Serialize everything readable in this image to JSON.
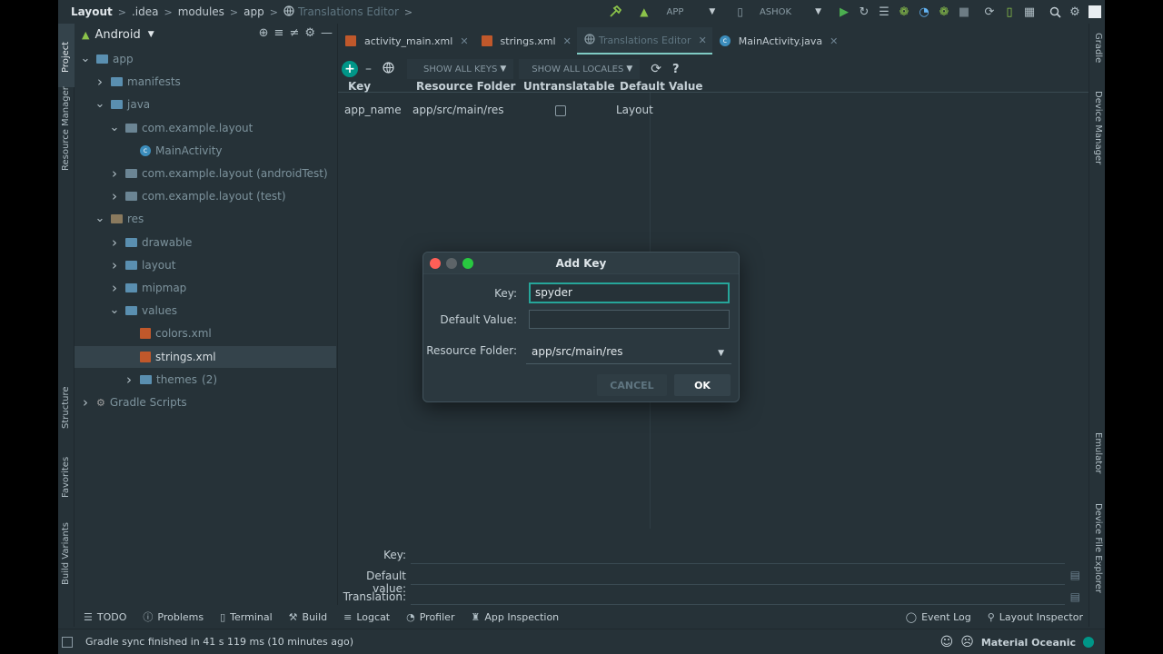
{
  "navbar": {
    "breadcrumbs": [
      "Layout",
      ".idea",
      "modules",
      "app",
      "Translations Editor"
    ],
    "run_config": "APP",
    "device": "ASHOK"
  },
  "left_strip": {
    "project": "Project",
    "resource_manager": "Resource Manager",
    "structure": "Structure",
    "favorites": "Favorites",
    "build_variants": "Build Variants"
  },
  "right_strip": {
    "gradle": "Gradle",
    "device_manager": "Device Manager",
    "emulator": "Emulator",
    "device_file_explorer": "Device File Explorer"
  },
  "project_panel": {
    "view_mode": "Android",
    "tree": [
      {
        "label": "app",
        "indent": 0,
        "icon": "folder-icon",
        "expanded": true,
        "style": "dim"
      },
      {
        "label": "manifests",
        "indent": 1,
        "icon": "folder-icon",
        "expanded": false,
        "style": "dim"
      },
      {
        "label": "java",
        "indent": 1,
        "icon": "folder-icon",
        "expanded": true,
        "style": "dim"
      },
      {
        "label": "com.example.layout",
        "indent": 2,
        "icon": "package-icon",
        "expanded": true,
        "style": "dim"
      },
      {
        "label": "MainActivity",
        "indent": 3,
        "icon": "class-icon",
        "expanded": null,
        "style": "dim"
      },
      {
        "label": "com.example.layout (androidTest)",
        "indent": 2,
        "icon": "package-icon",
        "expanded": false,
        "style": "dim"
      },
      {
        "label": "com.example.layout (test)",
        "indent": 2,
        "icon": "package-icon",
        "expanded": false,
        "style": "dim"
      },
      {
        "label": "res",
        "indent": 1,
        "icon": "res-folder-icon",
        "expanded": true,
        "style": "dim"
      },
      {
        "label": "drawable",
        "indent": 2,
        "icon": "folder-icon",
        "expanded": false,
        "style": "dim"
      },
      {
        "label": "layout",
        "indent": 2,
        "icon": "folder-icon",
        "expanded": false,
        "style": "dim"
      },
      {
        "label": "mipmap",
        "indent": 2,
        "icon": "folder-icon",
        "expanded": false,
        "style": "dim"
      },
      {
        "label": "values",
        "indent": 2,
        "icon": "folder-icon",
        "expanded": true,
        "style": "dim"
      },
      {
        "label": "colors.xml",
        "indent": 3,
        "icon": "xml-file-icon",
        "expanded": null,
        "style": "dim"
      },
      {
        "label": "strings.xml",
        "indent": 3,
        "icon": "xml-file-icon",
        "expanded": null,
        "style": "selected"
      },
      {
        "label": "themes",
        "extra": "(2)",
        "indent": 3,
        "icon": "folder-icon",
        "expanded": false,
        "style": "dim"
      },
      {
        "label": "Gradle Scripts",
        "indent": 0,
        "icon": "gradle-icon",
        "expanded": false,
        "style": "dim"
      }
    ]
  },
  "editor_tabs": [
    {
      "label": "activity_main.xml",
      "icon": "xml-file-icon",
      "active": false
    },
    {
      "label": "strings.xml",
      "icon": "xml-file-icon",
      "active": false
    },
    {
      "label": "Translations Editor",
      "icon": "globe-icon",
      "active": true
    },
    {
      "label": "MainActivity.java",
      "icon": "class-icon",
      "active": false
    }
  ],
  "translations_toolbar": {
    "show_keys": "SHOW ALL KEYS",
    "show_locales": "SHOW ALL LOCALES",
    "help": "?"
  },
  "table": {
    "headers": [
      "Key",
      "Resource Folder",
      "Untranslatable",
      "Default Value"
    ],
    "rows": [
      {
        "key": "app_name",
        "folder": "app/src/main/res",
        "untranslatable": false,
        "default_value": "Layout"
      }
    ]
  },
  "bottom_fields": {
    "key_label": "Key:",
    "default_label": "Default value:",
    "translation_label": "Translation:"
  },
  "dialog": {
    "title": "Add Key",
    "key_label": "Key:",
    "key_value": "spyder",
    "default_label": "Default Value:",
    "default_value": "",
    "folder_label": "Resource Folder:",
    "folder_value": "app/src/main/res",
    "cancel": "CANCEL",
    "ok": "OK"
  },
  "bottom_tools": {
    "todo": "TODO",
    "problems": "Problems",
    "terminal": "Terminal",
    "build": "Build",
    "logcat": "Logcat",
    "profiler": "Profiler",
    "app_inspection": "App Inspection",
    "event_log": "Event Log",
    "layout_inspector": "Layout Inspector"
  },
  "status": {
    "message": "Gradle sync finished in 41 s 119 ms (10 minutes ago)",
    "theme": "Material Oceanic"
  },
  "colors": {
    "background": "#263238",
    "accent": "#26a69a",
    "traffic_red": "#ff5f57",
    "traffic_gray": "#5d6468",
    "traffic_green": "#28c840"
  }
}
